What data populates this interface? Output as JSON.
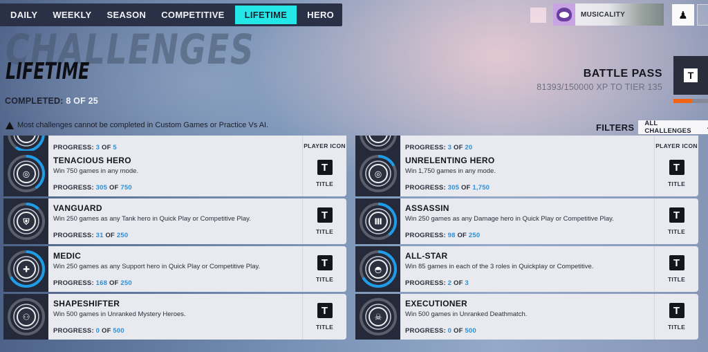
{
  "nav": {
    "tabs": [
      {
        "label": "DAILY",
        "active": false
      },
      {
        "label": "WEEKLY",
        "active": false
      },
      {
        "label": "SEASON",
        "active": false
      },
      {
        "label": "COMPETITIVE",
        "active": false
      },
      {
        "label": "LIFETIME",
        "active": true
      },
      {
        "label": "HERO",
        "active": false
      }
    ]
  },
  "profile": {
    "name": "MUSICALITY",
    "avatar_icon": "purple-creature-avatar",
    "social_icon": "social-friends-icon"
  },
  "header": {
    "background_title": "CHALLENGES",
    "title": "LIFETIME",
    "completed_label": "COMPLETED:",
    "completed_value": "8 OF 25"
  },
  "battle_pass": {
    "title": "BATTLE PASS",
    "subtitle": "81393/150000 XP TO TIER 135",
    "icon_letter": "T",
    "progress_fraction": 0.54
  },
  "warning": {
    "icon": "warning-triangle-icon",
    "text": "Most challenges cannot be completed in Custom Games or Practice Vs AI."
  },
  "filters": {
    "label": "FILTERS",
    "selected": "ALL CHALLENGES"
  },
  "colors": {
    "accent_tab": "#24e8e8",
    "progress_number": "#2a8fd6",
    "ring_progress": "#1f9ce8",
    "battle_pass_bar": "#f06414"
  },
  "challenges": [
    {
      "name": "",
      "description": "",
      "progress_label": "PROGRESS:",
      "current": "3",
      "of": "OF",
      "total": "5",
      "reward_label": "PLAYER ICON",
      "icon": "partial-icon",
      "fraction": 0.6
    },
    {
      "name": "",
      "description": "",
      "progress_label": "PROGRESS:",
      "current": "3",
      "of": "OF",
      "total": "20",
      "reward_label": "PLAYER ICON",
      "icon": "partial-icon",
      "fraction": 0.15
    },
    {
      "name": "TENACIOUS HERO",
      "description": "Win 750 games in any mode.",
      "progress_label": "PROGRESS:",
      "current": "305",
      "of": "OF",
      "total": "750",
      "reward_label": "TITLE",
      "icon": "overwatch-laurel-icon",
      "fraction": 0.4067
    },
    {
      "name": "UNRELENTING HERO",
      "description": "Win 1,750 games in any mode.",
      "progress_label": "PROGRESS:",
      "current": "305",
      "of": "OF",
      "total": "1,750",
      "reward_label": "TITLE",
      "icon": "overwatch-laurel-icon",
      "fraction": 0.1743
    },
    {
      "name": "VANGUARD",
      "description": "Win 250 games as any Tank hero in Quick Play or Competitive Play.",
      "progress_label": "PROGRESS:",
      "current": "31",
      "of": "OF",
      "total": "250",
      "reward_label": "TITLE",
      "icon": "tank-shield-icon",
      "fraction": 0.124
    },
    {
      "name": "ASSASSIN",
      "description": "Win 250 games as any Damage hero in Quick Play or Competitive Play.",
      "progress_label": "PROGRESS:",
      "current": "98",
      "of": "OF",
      "total": "250",
      "reward_label": "TITLE",
      "icon": "damage-bullets-icon",
      "fraction": 0.392
    },
    {
      "name": "MEDIC",
      "description": "Win 250 games as any Support hero in Quick Play or Competitive Play.",
      "progress_label": "PROGRESS:",
      "current": "168",
      "of": "OF",
      "total": "250",
      "reward_label": "TITLE",
      "icon": "support-cross-icon",
      "fraction": 0.672
    },
    {
      "name": "ALL-STAR",
      "description": "Win 85 games in each of the 3 roles in Quickplay or Competitive.",
      "progress_label": "PROGRESS:",
      "current": "2",
      "of": "OF",
      "total": "3",
      "reward_label": "TITLE",
      "icon": "overwatch-logo-icon",
      "fraction": 0.6667
    },
    {
      "name": "SHAPESHIFTER",
      "description": "Win 500 games in Unranked Mystery Heroes.",
      "progress_label": "PROGRESS:",
      "current": "0",
      "of": "OF",
      "total": "500",
      "reward_label": "TITLE",
      "icon": "mystery-heroes-icon",
      "fraction": 0
    },
    {
      "name": "EXECUTIONER",
      "description": "Win 500 games in Unranked Deathmatch.",
      "progress_label": "PROGRESS:",
      "current": "0",
      "of": "OF",
      "total": "500",
      "reward_label": "TITLE",
      "icon": "deathmatch-skull-icon",
      "fraction": 0
    }
  ],
  "reward_icon_letter": "T"
}
